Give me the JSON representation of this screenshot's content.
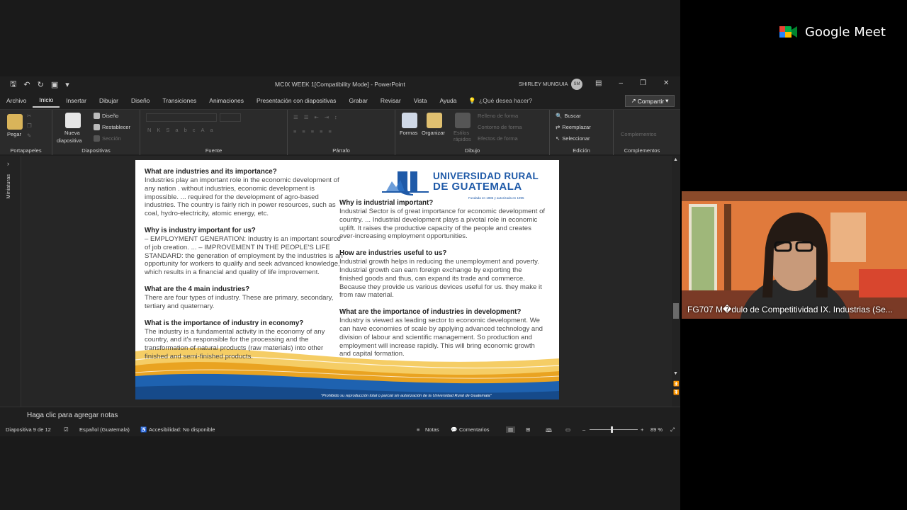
{
  "window": {
    "title": "MCIX WEEK 1[Compatibility Mode]  -  PowerPoint",
    "user_name": "SHIRLEY MUNGUIA",
    "user_initials": "SM"
  },
  "menu": {
    "tabs": [
      "Archivo",
      "Inicio",
      "Insertar",
      "Dibujar",
      "Diseño",
      "Transiciones",
      "Animaciones",
      "Presentación con diapositivas",
      "Grabar",
      "Revisar",
      "Vista",
      "Ayuda"
    ],
    "search_label": "¿Qué desea hacer?",
    "share_label": "Compartir"
  },
  "ribbon": {
    "portapapeles": {
      "label": "Portapapeles",
      "paste": "Pegar"
    },
    "diapositivas": {
      "label": "Diapositivas",
      "new_slide_1": "Nueva",
      "new_slide_2": "diapositiva",
      "layout": "Diseño",
      "reset": "Restablecer",
      "section": "Sección"
    },
    "fuente": {
      "label": "Fuente"
    },
    "parrafo": {
      "label": "Párrafo"
    },
    "dibujo": {
      "label": "Dibujo",
      "shapes": "Formas",
      "arrange": "Organizar",
      "quick_styles": "Estilos rápidos",
      "fill": "Relleno de forma",
      "outline": "Contorno de forma",
      "effects": "Efectos de forma"
    },
    "edicion": {
      "label": "Edición",
      "find": "Buscar",
      "replace": "Reemplazar",
      "select": "Seleccionar"
    },
    "complementos": {
      "label": "Complementos",
      "addins": "Complementos"
    }
  },
  "sidepane": {
    "label": "Miniaturas"
  },
  "slide": {
    "logo": {
      "line1": "UNIVERSIDAD RURAL",
      "line2": "DE GUATEMALA",
      "tagline": "Fundada en 1986 y autorizada en 1995"
    },
    "footer_note": "\"Prohibido su reproducción total o parcial sin autorización de la Universidad Rural de Guatemala\"",
    "left": [
      {
        "q": "What are industries and its importance?",
        "a": "Industries play an important role in the economic development of any nation . without industries, economic development is impossible. ... required for the development of agro-based industries. The country is fairly rich in power resources, such as coal, hydro-electricity, atomic energy, etc."
      },
      {
        "q": "Why is industry important for us?",
        "a": "– EMPLOYMENT GENERATION: Industry is an important source of job creation. ... – IMPROVEMENT IN THE PEOPLE'S LIFE STANDARD: the generation of employment by the industries is an opportunity for workers to qualify and seek advanced knowledge, which results in a financial and quality of life improvement."
      },
      {
        "q": "What are the 4 main industries?",
        "a": "There are four types of industry. These are primary, secondary, tertiary and quaternary."
      },
      {
        "q": "What is the importance of industry in economy?",
        "a": "The industry is a fundamental activity in the economy of any country, and it's responsible for the processing and the transformation of natural products (raw materials) into other finished and semi-finished products."
      }
    ],
    "right": [
      {
        "q": "Why is industrial important?",
        "a": "Industrial Sector is of great importance for economic development of country. ... Industrial development plays a pivotal role in economic uplift. It raises the productive capacity of the people and creates ever-increasing employment opportunities."
      },
      {
        "q": "How are industries useful to us?",
        "a": "Industrial growth helps in reducing the unemployment and poverty. Industrial growth can earn foreign exchange by exporting the finished goods and thus, can expand its trade and commerce. Because they provide us various devices useful for us. they make it from raw material."
      },
      {
        "q": "What are the importance of industries in development?",
        "a": "Industry is viewed as leading sector to economic development. We can have economies of scale by applying advanced technology and division of labour and scientific management. So production and employment will increase rapidly. This will bring economic growth and capital formation."
      }
    ]
  },
  "notes": {
    "placeholder": "Haga clic para agregar notas"
  },
  "status": {
    "slide_info": "Diapositiva 9 de 12",
    "language": "Español (Guatemala)",
    "accessibility": "Accesibilidad: No disponible",
    "notes": "Notas",
    "comments": "Comentarios",
    "zoom": "89 %"
  },
  "meet": {
    "brand": "Google Meet",
    "caption": "FG707 M�dulo de Competitividad IX. Industrias (Se..."
  },
  "colors": {
    "brand_blue": "#1f5aa8",
    "gold": "#f0b42a",
    "ribbon_bg": "#2b2b2b"
  }
}
